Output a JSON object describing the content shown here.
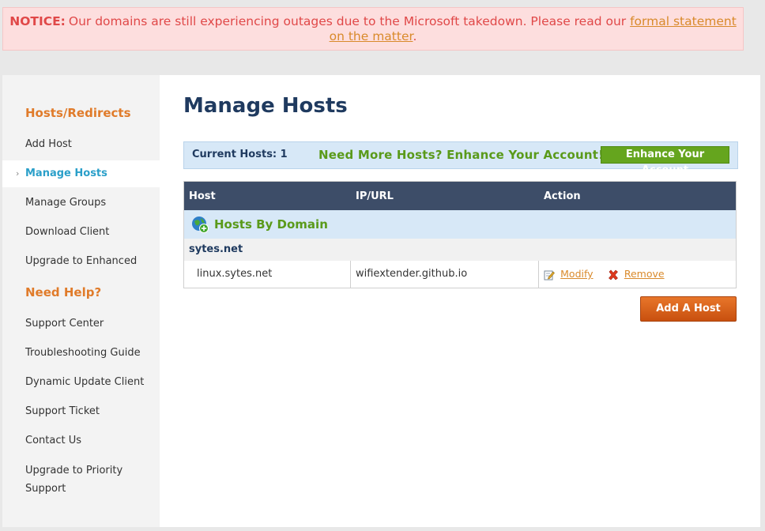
{
  "notice": {
    "label": "NOTICE:",
    "text": "Our domains are still experiencing outages due to the Microsoft takedown. Please read our ",
    "link_text": "formal statement on the matter",
    "end": "."
  },
  "sidebar": {
    "section1_heading": "Hosts/Redirects",
    "items1": [
      {
        "label": "Add Host"
      },
      {
        "label": "Manage Hosts"
      },
      {
        "label": "Manage Groups"
      },
      {
        "label": "Download Client"
      },
      {
        "label": "Upgrade to Enhanced"
      }
    ],
    "section2_heading": "Need Help?",
    "items2": [
      {
        "label": "Support Center"
      },
      {
        "label": "Troubleshooting Guide"
      },
      {
        "label": "Dynamic Update Client"
      },
      {
        "label": "Support Ticket"
      },
      {
        "label": "Contact Us"
      },
      {
        "label_line1": "Upgrade to Priority",
        "label_line2": "Support"
      }
    ],
    "active": "Manage Hosts"
  },
  "main": {
    "title": "Manage Hosts",
    "current_hosts_label": "Current Hosts: 1",
    "promo_text": "Need More Hosts? Enhance Your Account!",
    "enhance_button": "Enhance Your Account",
    "table": {
      "headers": [
        "Host",
        "IP/URL",
        "Action"
      ],
      "domain_heading": "Hosts By Domain",
      "group": "sytes.net",
      "rows": [
        {
          "host": "linux.sytes.net",
          "ip": "wifiextender.github.io",
          "modify": "Modify",
          "remove": "Remove"
        }
      ]
    },
    "add_host_button": "Add A Host"
  },
  "colors": {
    "accent_orange": "#e07b2a",
    "link_orange": "#d98a2b",
    "navy": "#1f3a5f",
    "green": "#5a9a1a",
    "active_blue": "#2a9fc9",
    "header_bg": "#3d4d68"
  },
  "icons": [
    "globe-add-icon",
    "edit-icon",
    "delete-x-icon",
    "chevron-right-icon"
  ]
}
